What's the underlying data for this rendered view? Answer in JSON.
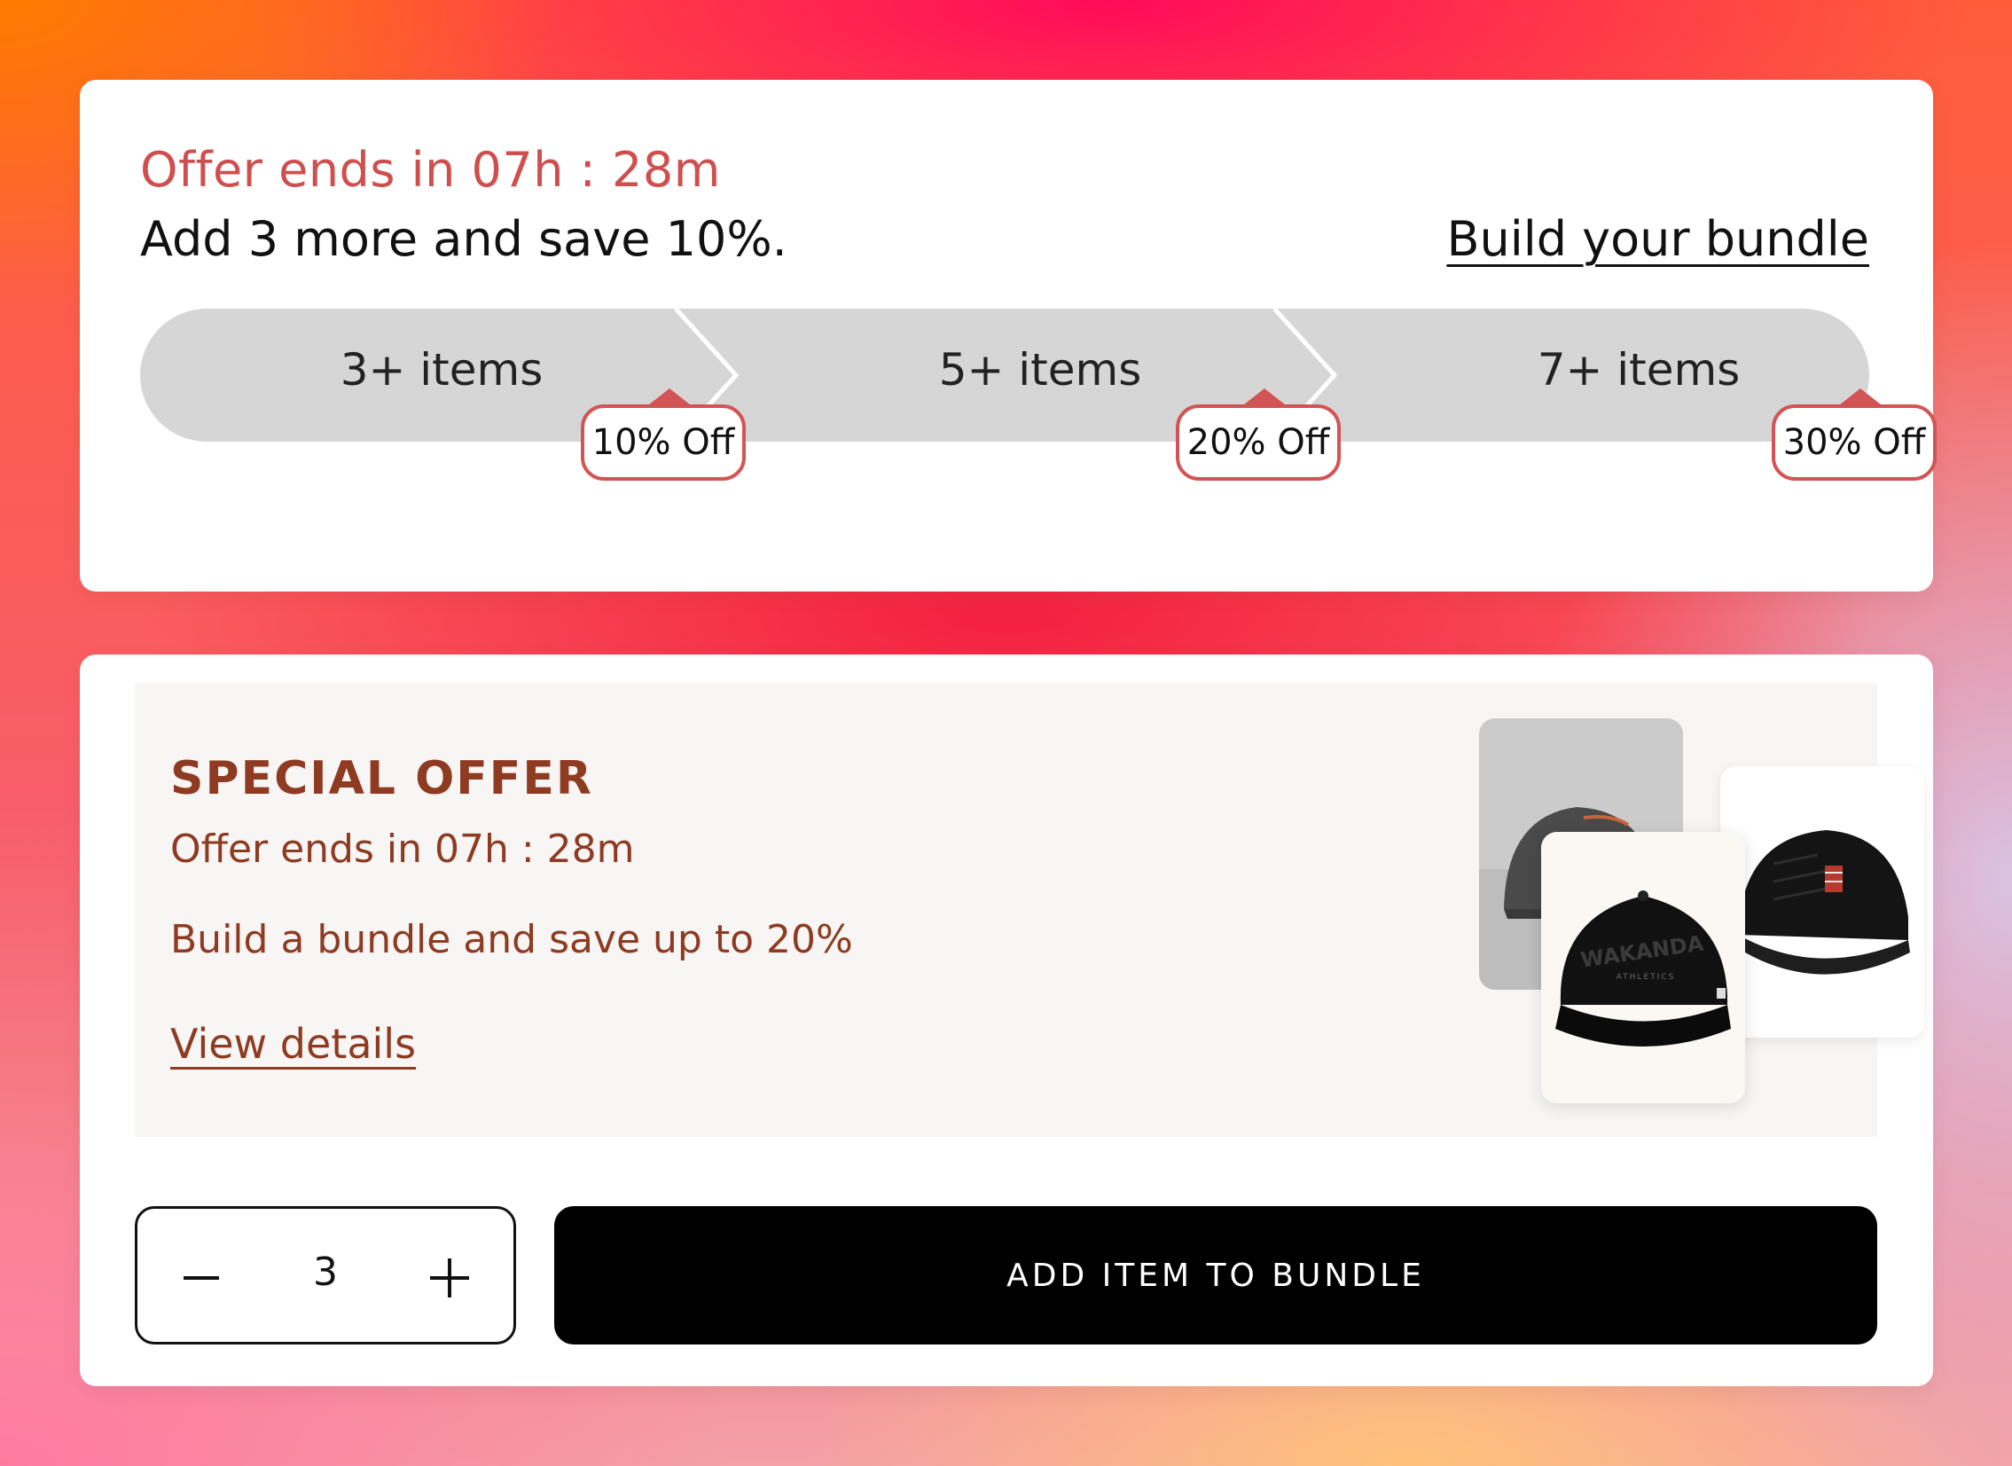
{
  "bundle_progress": {
    "timer_text": "Offer ends in 07h : 28m",
    "progress_text": "Add 3 more and save 10%.",
    "build_link": "Build your bundle",
    "tiers": [
      {
        "label": "3+ items",
        "badge": "10% Off"
      },
      {
        "label": "5+ items",
        "badge": "20% Off"
      },
      {
        "label": "7+ items",
        "badge": "30% Off"
      }
    ],
    "colors": {
      "accent": "#d35454",
      "track": "#d6d6d6"
    }
  },
  "special_offer": {
    "title": "SPECIAL OFFER",
    "timer_text": "Offer ends in 07h : 28m",
    "description": "Build a bundle and save up to 20%",
    "link": "View details",
    "images": [
      "grey-cap-image",
      "black-cap-flag-image",
      "wakanda-cap-image"
    ],
    "cap_text": "WAKANDA",
    "cap_subtext": "ATHLETICS",
    "colors": {
      "text": "#8e3b22",
      "panel": "#f8f6f4"
    }
  },
  "cart": {
    "quantity": "3",
    "decrement_icon": "minus-icon",
    "increment_icon": "plus-icon",
    "add_button": "ADD ITEM TO BUNDLE"
  }
}
